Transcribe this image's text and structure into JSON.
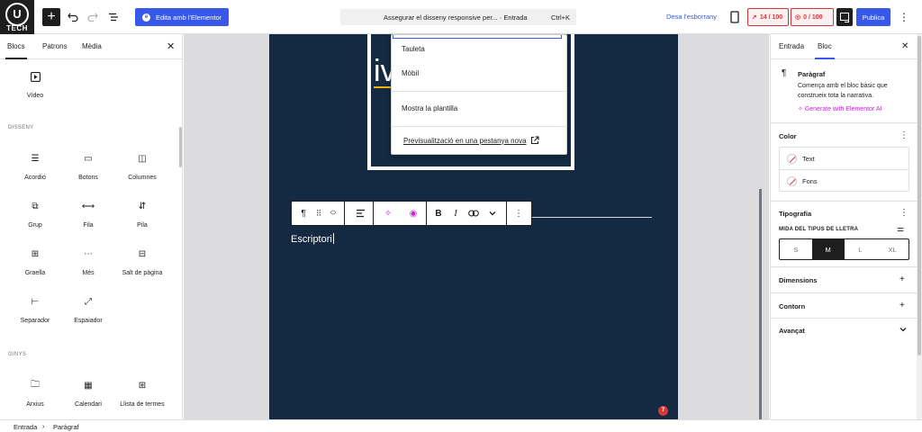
{
  "topbar": {
    "logo_letter": "U",
    "logo_text": "TECH",
    "add_icon": "plus-icon",
    "undo_icon": "undo-icon",
    "redo_icon": "redo-icon",
    "outline_icon": "list-view-icon",
    "elementor_label": "Edita amb l'Elementor",
    "command_title": "Assegurar el disseny responsive per... · Entrada",
    "command_shortcut": "Ctrl+K",
    "save_draft": "Desa l'esborrany",
    "score_a": "14 / 100",
    "score_b": "0 / 100",
    "publish": "Publica"
  },
  "inserter": {
    "tabs": [
      "Blocs",
      "Patrons",
      "Mèdia"
    ],
    "top_block": {
      "label": "Vídeo",
      "icon": "video-icon"
    },
    "design_heading": "DISSENY",
    "design_blocks": [
      {
        "label": "Acordió",
        "icon": "accordion-icon"
      },
      {
        "label": "Botons",
        "icon": "buttons-icon"
      },
      {
        "label": "Columnes",
        "icon": "columns-icon"
      },
      {
        "label": "Grup",
        "icon": "group-icon"
      },
      {
        "label": "Fila",
        "icon": "row-icon"
      },
      {
        "label": "Pila",
        "icon": "stack-icon"
      },
      {
        "label": "Graella",
        "icon": "grid-icon"
      },
      {
        "label": "Més",
        "icon": "more-icon"
      },
      {
        "label": "Salt de pàgina",
        "icon": "page-break-icon"
      },
      {
        "label": "Separador",
        "icon": "separator-icon"
      },
      {
        "label": "Espaiador",
        "icon": "spacer-icon"
      }
    ],
    "widgets_heading": "GINYS",
    "widget_blocks": [
      {
        "label": "Arxius",
        "icon": "archive-icon"
      },
      {
        "label": "Calendari",
        "icon": "calendar-icon"
      },
      {
        "label": "Llista de termes",
        "icon": "terms-list-icon"
      }
    ]
  },
  "canvas": {
    "hero_letters": "iv",
    "dropdown_items": [
      "Tauleta",
      "Mòbil"
    ],
    "dropdown_template": "Mostra la plantilla",
    "dropdown_preview_link": "Previsualització en una pestanya nova",
    "paragraph_text": "Escriptori",
    "notification_count": "7"
  },
  "settings": {
    "tabs": [
      "Entrada",
      "Bloc"
    ],
    "block_name": "Paràgraf",
    "block_desc": "Comença amb el bloc bàsic que construeix tota la narrativa.",
    "ai_link": "Generate with Elementor AI",
    "color_title": "Color",
    "color_items": [
      "Text",
      "Fons"
    ],
    "typography_title": "Tipografia",
    "font_size_label": "MIDA DEL TIPUS DE LLETRA",
    "font_sizes": [
      "S",
      "M",
      "L",
      "XL"
    ],
    "font_size_selected": "M",
    "dimensions_title": "Dimensions",
    "border_title": "Contorn",
    "advanced_title": "Avançat"
  },
  "footer": {
    "crumbs": [
      "Entrada",
      "Paràgraf"
    ]
  },
  "colors": {
    "accent": "#3858e9",
    "canvas_bg": "#132a42",
    "score_red": "#d63638",
    "ai_magenta": "#c026d3"
  }
}
